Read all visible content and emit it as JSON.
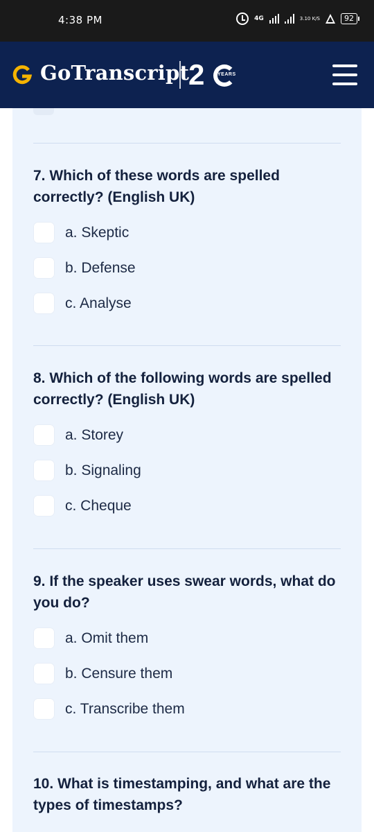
{
  "status_bar": {
    "time": "4:38 PM",
    "network": "4G",
    "speed": "3.10 K/S",
    "battery": "92"
  },
  "header": {
    "brand": "GoTranscript",
    "years_number": "2",
    "years_word": "YEARS",
    "colors": {
      "background": "#0d2250",
      "logo_accent": "#f5b301"
    }
  },
  "questions": [
    {
      "title": "7. Which of these words are spelled correctly? (English UK)",
      "options": [
        "a. Skeptic",
        "b. Defense",
        "c. Analyse"
      ]
    },
    {
      "title": "8. Which of the following words are spelled correctly? (English UK)",
      "options": [
        "a. Storey",
        "b. Signaling",
        "c. Cheque"
      ]
    },
    {
      "title": "9. If the speaker uses swear words, what do you do?",
      "options": [
        "a. Omit them",
        "b. Censure them",
        "c. Transcribe them"
      ]
    },
    {
      "title": "10. What is timestamping, and what are the types of timestamps?",
      "options": []
    }
  ]
}
